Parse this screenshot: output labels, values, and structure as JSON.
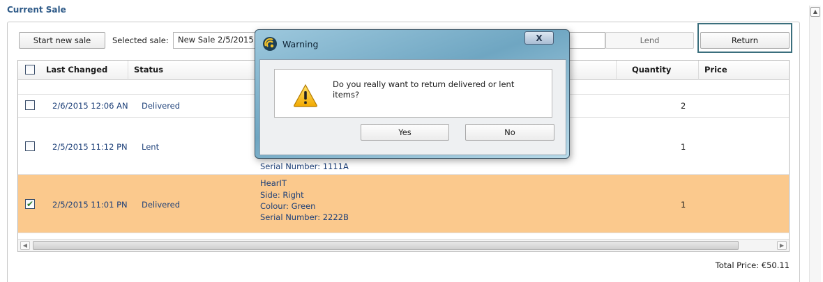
{
  "section": {
    "title": "Current Sale"
  },
  "toolbar": {
    "start_new_sale": "Start new sale",
    "selected_sale_label": "Selected sale:",
    "selected_sale_value": "New Sale 2/5/2015",
    "lend": "Lend",
    "return": "Return"
  },
  "grid": {
    "headers": {
      "last_changed": "Last Changed",
      "status": "Status",
      "quantity": "Quantity",
      "price": "Price"
    },
    "rows": [
      {
        "checked": false,
        "last_changed": "2/6/2015 12:06 AN",
        "status": "Delivered",
        "quantity": "2",
        "details": []
      },
      {
        "checked": false,
        "last_changed": "2/5/2015 11:12 PN",
        "status": "Lent",
        "quantity": "1",
        "details": [
          "Serial Number: 1111A"
        ]
      },
      {
        "checked": true,
        "last_changed": "2/5/2015 11:01 PN",
        "status": "Delivered",
        "quantity": "1",
        "details": [
          "HearIT",
          "Side: Right",
          "Colour: Green",
          "Serial Number: 2222B"
        ]
      }
    ],
    "check_mark": "✔"
  },
  "total": "Total Price: €50.11",
  "dialog": {
    "title": "Warning",
    "close_glyph": "X",
    "message": "Do you really want to return delivered or lent items?",
    "yes": "Yes",
    "no": "No"
  },
  "icons": {
    "warning": "warning-triangle-icon",
    "app_logo": "app-logo-icon",
    "close": "close-icon"
  },
  "colors": {
    "selected_row": "#fbc98d",
    "link_text": "#1c3f78",
    "section_title": "#2e5a88",
    "dialog_frame": "#7fb3cc"
  }
}
